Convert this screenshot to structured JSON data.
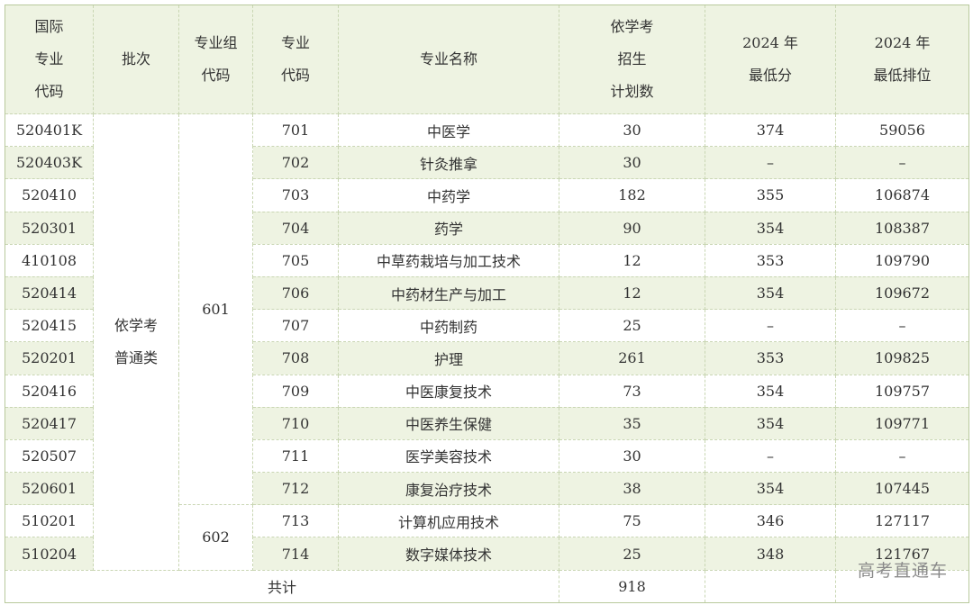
{
  "header": {
    "col1": [
      "国际",
      "专业",
      "代码"
    ],
    "col2": [
      "批次"
    ],
    "col3": [
      "专业组",
      "代码"
    ],
    "col4": [
      "专业",
      "代码"
    ],
    "col5": [
      "专业名称"
    ],
    "col6": [
      "依学考",
      "招生",
      "计划数"
    ],
    "col7": [
      "2024 年",
      "最低分"
    ],
    "col8": [
      "2024 年",
      "最低排位"
    ]
  },
  "batch": [
    "依学考",
    "普通类"
  ],
  "groups": [
    "601",
    "602"
  ],
  "rows": [
    {
      "intl_code": "520401K",
      "code": "701",
      "name": "中医学",
      "plan": "30",
      "min_score": "374",
      "min_rank": "59056"
    },
    {
      "intl_code": "520403K",
      "code": "702",
      "name": "针灸推拿",
      "plan": "30",
      "min_score": "–",
      "min_rank": "–"
    },
    {
      "intl_code": "520410",
      "code": "703",
      "name": "中药学",
      "plan": "182",
      "min_score": "355",
      "min_rank": "106874"
    },
    {
      "intl_code": "520301",
      "code": "704",
      "name": "药学",
      "plan": "90",
      "min_score": "354",
      "min_rank": "108387"
    },
    {
      "intl_code": "410108",
      "code": "705",
      "name": "中草药栽培与加工技术",
      "plan": "12",
      "min_score": "353",
      "min_rank": "109790"
    },
    {
      "intl_code": "520414",
      "code": "706",
      "name": "中药材生产与加工",
      "plan": "12",
      "min_score": "354",
      "min_rank": "109672"
    },
    {
      "intl_code": "520415",
      "code": "707",
      "name": "中药制药",
      "plan": "25",
      "min_score": "–",
      "min_rank": "–"
    },
    {
      "intl_code": "520201",
      "code": "708",
      "name": "护理",
      "plan": "261",
      "min_score": "353",
      "min_rank": "109825"
    },
    {
      "intl_code": "520416",
      "code": "709",
      "name": "中医康复技术",
      "plan": "73",
      "min_score": "354",
      "min_rank": "109757"
    },
    {
      "intl_code": "520417",
      "code": "710",
      "name": "中医养生保健",
      "plan": "35",
      "min_score": "354",
      "min_rank": "109771"
    },
    {
      "intl_code": "520507",
      "code": "711",
      "name": "医学美容技术",
      "plan": "30",
      "min_score": "–",
      "min_rank": "–"
    },
    {
      "intl_code": "520601",
      "code": "712",
      "name": "康复治疗技术",
      "plan": "38",
      "min_score": "354",
      "min_rank": "107445"
    },
    {
      "intl_code": "510201",
      "code": "713",
      "name": "计算机应用技术",
      "plan": "75",
      "min_score": "346",
      "min_rank": "127117"
    },
    {
      "intl_code": "510204",
      "code": "714",
      "name": "数字媒体技术",
      "plan": "25",
      "min_score": "348",
      "min_rank": "121767"
    }
  ],
  "total": {
    "label": "共计",
    "plan": "918"
  },
  "watermark": "高考直通车",
  "colors": {
    "header_bg": "#eef3e2",
    "stripe_bg": "#eef3e2",
    "border": "#c9d6b3"
  }
}
